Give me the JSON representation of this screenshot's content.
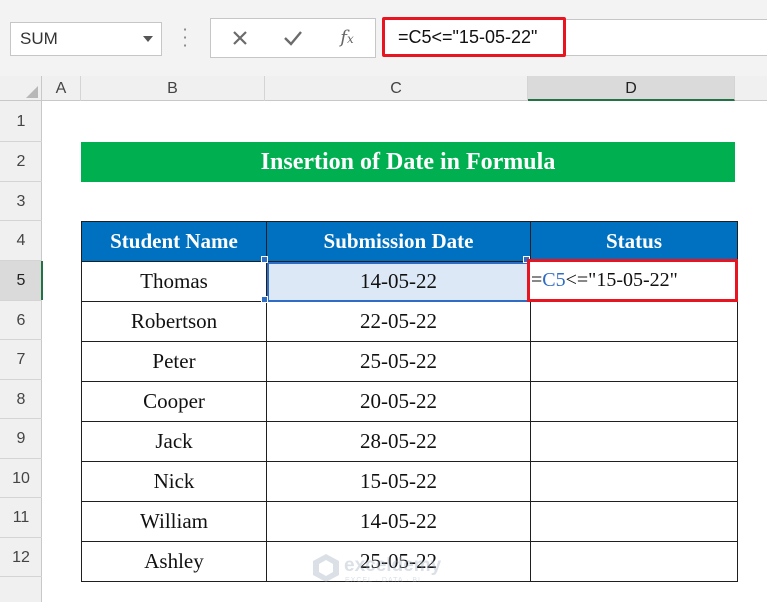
{
  "formula_bar": {
    "name_box": "SUM",
    "formula_text": "=C5<=\"15-05-22\"",
    "icons": [
      "cancel-icon",
      "enter-check-icon",
      "insert-function-icon"
    ]
  },
  "columns": [
    "A",
    "B",
    "C",
    "D"
  ],
  "selected_column": "D",
  "rows": [
    "1",
    "2",
    "3",
    "4",
    "5",
    "6",
    "7",
    "8",
    "9",
    "10",
    "11",
    "12"
  ],
  "selected_row": "5",
  "title": "Insertion of Date in Formula",
  "table": {
    "headers": [
      "Student Name",
      "Submission Date",
      "Status"
    ],
    "rows": [
      {
        "name": "Thomas",
        "date": "14-05-22",
        "status": ""
      },
      {
        "name": "Robertson",
        "date": "22-05-22",
        "status": ""
      },
      {
        "name": "Peter",
        "date": "25-05-22",
        "status": ""
      },
      {
        "name": "Cooper",
        "date": "20-05-22",
        "status": ""
      },
      {
        "name": "Jack",
        "date": "28-05-22",
        "status": ""
      },
      {
        "name": "Nick",
        "date": "15-05-22",
        "status": ""
      },
      {
        "name": "William",
        "date": "14-05-22",
        "status": ""
      },
      {
        "name": "Ashley",
        "date": "25-05-22",
        "status": ""
      }
    ]
  },
  "editing_cell": {
    "prefix": "=",
    "ref": "C5",
    "suffix": "<=\"15-05-22\""
  },
  "watermark": {
    "name": "exceldemy",
    "tagline": "EXCEL · DATA · BI"
  },
  "colors": {
    "title_bg": "#00b050",
    "header_bg": "#0070c0",
    "highlight_border": "#e8141f",
    "selection": "#2f6cc4"
  }
}
